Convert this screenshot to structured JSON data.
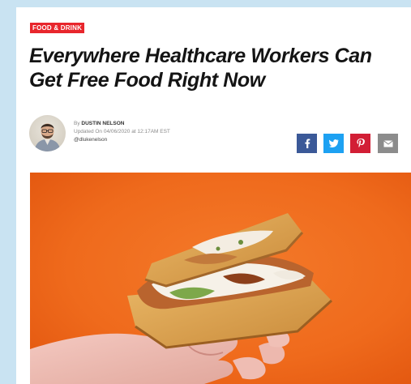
{
  "article": {
    "category": "FOOD & DRINK",
    "headline": "Everywhere Healthcare Workers Can Get Free Food Right Now",
    "byline_prefix": "By",
    "author": "DUSTIN NELSON",
    "updated": "Updated On 04/06/2020 at 12:17AM EST",
    "handle": "@dlukenelson"
  },
  "share": {
    "facebook_icon": "facebook-icon",
    "twitter_icon": "twitter-icon",
    "pinterest_icon": "pinterest-icon",
    "email_icon": "email-icon"
  },
  "colors": {
    "page_bg": "#c9e3f2",
    "category_bg": "#e8262c",
    "facebook": "#3b5998",
    "twitter": "#1da1f2",
    "pinterest": "#d21e35",
    "email": "#8c8c8c",
    "hero_bg": "#f2691e"
  }
}
